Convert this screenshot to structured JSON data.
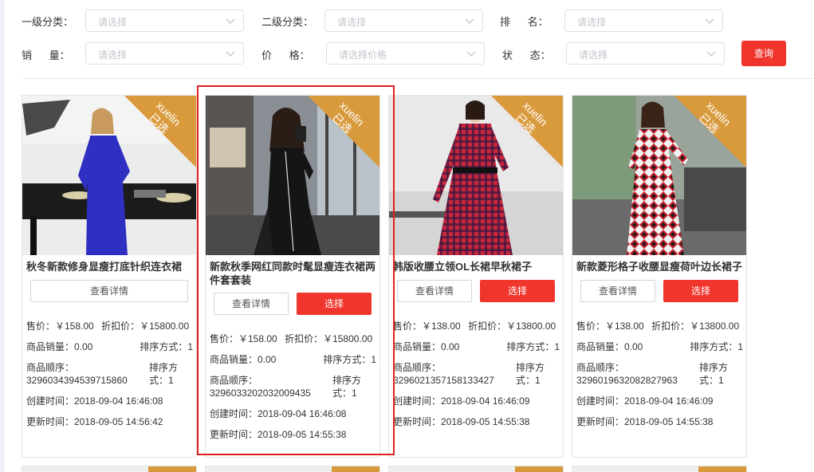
{
  "filters": {
    "row1": [
      {
        "label": "一级分类：",
        "placeholder": "请选择"
      },
      {
        "label": "二级分类：",
        "placeholder": "请选择"
      },
      {
        "label": "排      名：",
        "placeholder": "请选择"
      }
    ],
    "row2": [
      {
        "label": "销      量：",
        "placeholder": "请选择"
      },
      {
        "label": "价      格：",
        "placeholder": "请选择价格"
      },
      {
        "label": "状      态：",
        "placeholder": "请选择"
      }
    ],
    "query_label": "查询"
  },
  "badge": {
    "line1": "xuelin",
    "line2": "已选"
  },
  "buttons": {
    "detail": "查看详情",
    "select": "选择"
  },
  "products": [
    {
      "title": "秋冬新款修身显瘦打底针织连衣裙",
      "price": "售价：￥158.00",
      "discount": "折扣价：￥15800.00",
      "sales": "商品销量：0.00",
      "sort": "排序方式：1",
      "order_label": "商品顺序：",
      "order_value": "3296034394539715860",
      "sort2": "排序方式：1",
      "created": "创建时间：2018-09-04 16:46:08",
      "updated": "更新时间：2018-09-05 14:56:42",
      "has_select": false,
      "image": "blue-dress-photo"
    },
    {
      "title": "新款秋季网红同款时髦显瘦连衣裙两件套套装",
      "price": "售价：￥158.00",
      "discount": "折扣价：￥15800.00",
      "sales": "商品销量：0.00",
      "sort": "排序方式：1",
      "order_label": "商品顺序：",
      "order_value": "3296033202032009435",
      "sort2": "排序方式：1",
      "created": "创建时间：2018-09-04 16:46:08",
      "updated": "更新时间：2018-09-05 14:55:38",
      "has_select": true,
      "image": "black-dress-photo"
    },
    {
      "title": "韩版收腰立领OL长裙早秋裙子",
      "price": "售价：￥138.00",
      "discount": "折扣价：￥13800.00",
      "sales": "商品销量：0.00",
      "sort": "排序方式：1",
      "order_label": "商品顺序：",
      "order_value": "3296021357158133427",
      "sort2": "排序方式：1",
      "created": "创建时间：2018-09-04 16:46:09",
      "updated": "更新时间：2018-09-05 14:55:38",
      "has_select": true,
      "image": "plaid-dress-photo"
    },
    {
      "title": "新款菱形格子收腰显瘦荷叶边长裙子",
      "price": "售价：￥138.00",
      "discount": "折扣价：￥13800.00",
      "sales": "商品销量：0.00",
      "sort": "排序方式：1",
      "order_label": "商品顺序：",
      "order_value": "3296019632082827963",
      "sort2": "排序方式：1",
      "created": "创建时间：2018-09-04 16:46:09",
      "updated": "更新时间：2018-09-05 14:55:38",
      "has_select": true,
      "image": "diamond-dress-photo"
    }
  ],
  "colors": {
    "accent": "#f0352c",
    "ribbon": "#d99a3c",
    "highlight": "#e02020"
  }
}
